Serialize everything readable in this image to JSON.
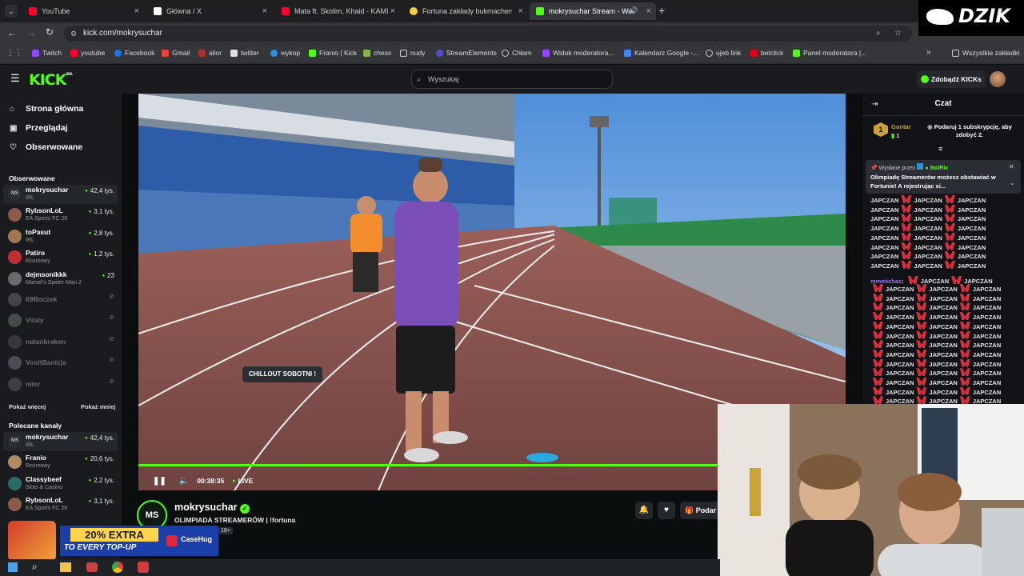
{
  "browser": {
    "tabs": [
      {
        "label": "YouTube",
        "color": "#ff0033"
      },
      {
        "label": "Główna / X",
        "color": "#ffffff"
      },
      {
        "label": "Mata ft. Skolim, Khaid - KAMIK",
        "color": "#ff0033"
      },
      {
        "label": "Fortuna zakłady bukmacherskie",
        "color": "#f4d03f"
      },
      {
        "label": "mokrysuchar Stream - Wat",
        "color": "#53fc18"
      }
    ],
    "url": "kick.com/mokrysuchar",
    "bookmarks": [
      "Twitch",
      "youtube",
      "Facebook",
      "Gmail",
      "alior",
      "twitter",
      "wykop",
      "Franio | Kick",
      "chess",
      "nudy",
      "StreamElements",
      "Chłam",
      "Widok moderatora...",
      "Kalendarz Google -...",
      "ujeb link",
      "betclick",
      "Panel moderatora |..."
    ],
    "all_bookmarks": "Wszystkie zakładki"
  },
  "kick": {
    "logo": "KICK",
    "logo_badge": "BETA",
    "search_placeholder": "Wyszukaj",
    "kicks_button": "Zdobądź KICKs",
    "nav": [
      "Strona główna",
      "Przeglądaj",
      "Obserwowane"
    ],
    "followed_title": "Obserwowane",
    "followed": [
      {
        "name": "mokrysuchar",
        "category": "IRL",
        "viewers": "42,4 tys.",
        "online": true,
        "initials": "MS",
        "color": "#2b2e33"
      },
      {
        "name": "RybsonLoL",
        "category": "EA Sports FC 26",
        "viewers": "3,1 tys.",
        "online": true,
        "initials": "",
        "color": "#8a5a4a"
      },
      {
        "name": "toPasut",
        "category": "IRL",
        "viewers": "2,8 tys.",
        "online": true,
        "initials": "",
        "color": "#a07850"
      },
      {
        "name": "Patiro",
        "category": "Rozmowy",
        "viewers": "1,2 tys.",
        "online": true,
        "initials": "",
        "color": "#c03030"
      },
      {
        "name": "dejmsonikkk",
        "category": "Marvel's Spider-Man 2",
        "viewers": "23",
        "online": true,
        "initials": "",
        "color": "#6a6a6a"
      },
      {
        "name": "69Boczek",
        "category": "",
        "viewers": "",
        "online": false,
        "initials": "",
        "color": "#7a7a7a"
      },
      {
        "name": "Vitaly",
        "category": "",
        "viewers": "",
        "online": false,
        "initials": "",
        "color": "#7a8a7a"
      },
      {
        "name": "natankraken",
        "category": "",
        "viewers": "",
        "online": false,
        "initials": "",
        "color": "#5a5a6a"
      },
      {
        "name": "VooltBanicja",
        "category": "",
        "viewers": "",
        "online": false,
        "initials": "",
        "color": "#8a8a9a"
      },
      {
        "name": "niter",
        "category": "",
        "viewers": "",
        "online": false,
        "initials": "",
        "color": "#6a6a6a"
      }
    ],
    "show_more": "Pokaż więcej",
    "show_less": "Pokaż mniej",
    "recommended_title": "Polecane kanały",
    "recommended": [
      {
        "name": "mokrysuchar",
        "category": "IRL",
        "viewers": "42,4 tys.",
        "initials": "MS",
        "color": "#2b2e33"
      },
      {
        "name": "Franio",
        "category": "Rozmowy",
        "viewers": "20,6 tys.",
        "initials": "",
        "color": "#b08a60"
      },
      {
        "name": "Classybeef",
        "category": "Slots & Casino",
        "viewers": "2,2 tys.",
        "initials": "",
        "color": "#2a6a6a"
      },
      {
        "name": "RybsonLoL",
        "category": "EA Sports FC 26",
        "viewers": "3,1 tys.",
        "initials": "",
        "color": "#8a5a4a"
      }
    ]
  },
  "player": {
    "tooltip": "CHILLOUT SOBOTNI !",
    "time": "00:38:35",
    "live": "LIVE"
  },
  "stream": {
    "avatar_initials": "MS",
    "name": "mokrysuchar",
    "title": "OLIMPIADA STREAMERÓW | !fortuna",
    "age_badge": "18+",
    "gift_label": "Podar"
  },
  "chat": {
    "title": "Czat",
    "leader_rank": "1",
    "leader_name": "Gontar",
    "leader_count": "1",
    "gift_prompt": "Podaruj 1 subskrypcję, aby zdobyć 2.",
    "pinned_by": "Wysłane przez",
    "pinned_author": "BotRix",
    "pinned_text": "Olimpiadę Streamerów możesz obstawiać w Fortunie! A rejestrując si...",
    "spam_word": "JAPCZAN",
    "spam_user": "mmmichas",
    "spam_user_color": "#a970ff"
  },
  "overlay": {
    "brand": "DZIK",
    "ad_headline": "20% EXTRA",
    "ad_sub": "TO EVERY TOP-UP",
    "ad_brand": "CaseHug"
  }
}
